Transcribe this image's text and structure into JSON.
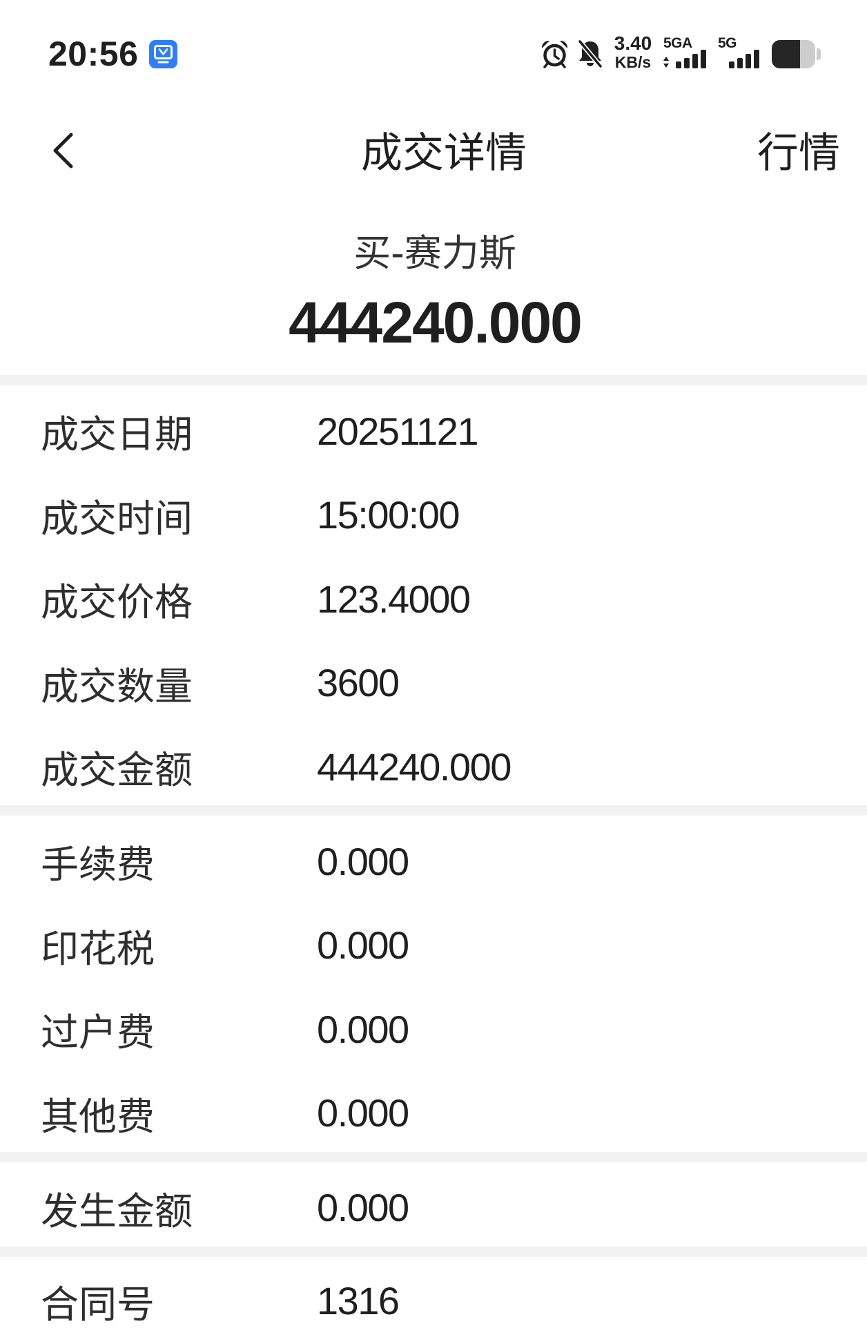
{
  "status_bar": {
    "time": "20:56",
    "net_speed": {
      "value": "3.40",
      "unit": "KB/s"
    },
    "sim1": {
      "network": "5GA",
      "signal_level": 4,
      "signal_max": 4
    },
    "sim2": {
      "network": "5G",
      "signal_level": 4,
      "signal_max": 4
    },
    "battery_level": 0.65,
    "icons": {
      "app": "screen-cast-icon",
      "alarm": "alarm-clock-icon",
      "ringer": "bell-muted-icon",
      "data_arrows": "data-transfer-arrows-icon",
      "battery": "battery-icon"
    }
  },
  "nav": {
    "back_icon": "chevron-left-icon",
    "title": "成交详情",
    "right_action": "行情"
  },
  "summary": {
    "side_and_stock": "买-赛力斯",
    "amount": "444240.000"
  },
  "groups": [
    {
      "rows": [
        {
          "label": "成交日期",
          "value": "20251121"
        },
        {
          "label": "成交时间",
          "value": "15:00:00"
        },
        {
          "label": "成交价格",
          "value": "123.4000"
        },
        {
          "label": "成交数量",
          "value": "3600"
        },
        {
          "label": "成交金额",
          "value": "444240.000"
        }
      ]
    },
    {
      "rows": [
        {
          "label": "手续费",
          "value": "0.000"
        },
        {
          "label": "印花税",
          "value": "0.000"
        },
        {
          "label": "过户费",
          "value": "0.000"
        },
        {
          "label": "其他费",
          "value": "0.000"
        }
      ]
    },
    {
      "rows": [
        {
          "label": "发生金额",
          "value": "0.000"
        }
      ]
    },
    {
      "rows": [
        {
          "label": "合同号",
          "value": "1316"
        }
      ]
    }
  ],
  "colors": {
    "text": "#1f1f1f",
    "label": "#2e2e2e",
    "divider": "#f2f2f2",
    "app_icon_blue": "#2f7ef6",
    "battery_fill": "#262626",
    "battery_empty": "#cdcdcd"
  }
}
